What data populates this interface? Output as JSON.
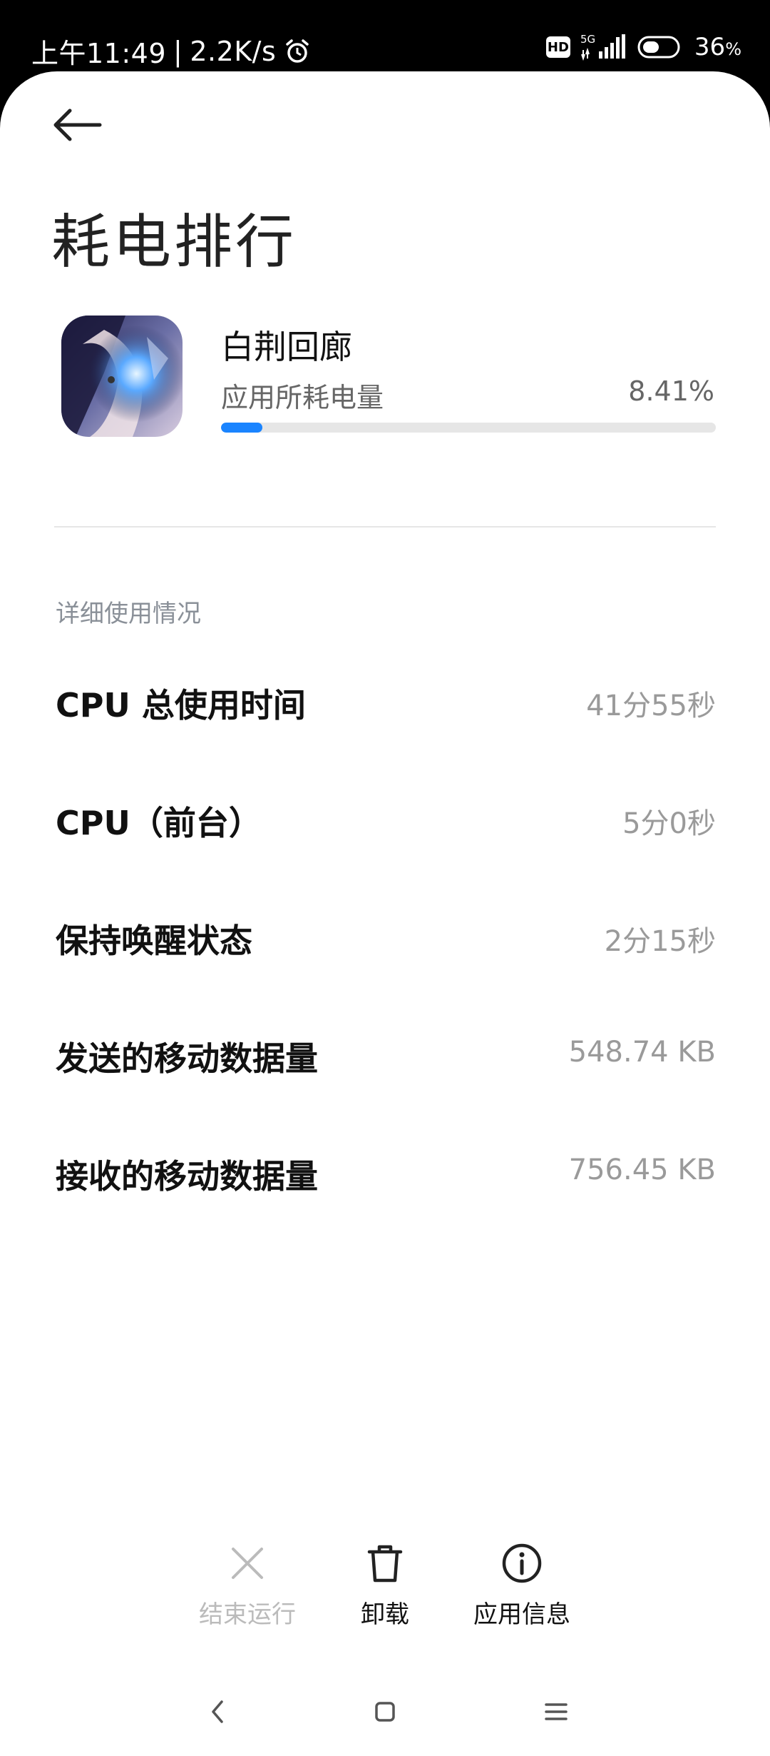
{
  "status_bar": {
    "time": "上午11:49",
    "net_speed": "2.2K/s",
    "hd": "HD",
    "network": "5G",
    "battery": "36",
    "battery_unit": "%",
    "icons": [
      "alarm-icon",
      "hd-icon",
      "signal-icon",
      "battery-icon"
    ]
  },
  "header": {
    "title": "耗电排行"
  },
  "app": {
    "name": "白荆回廊",
    "usage_label": "应用所耗电量",
    "usage_percent": "8.41%",
    "usage_fraction": 0.0841,
    "accent_color": "#1a84ff"
  },
  "details": {
    "section_title": "详细使用情况",
    "rows": [
      {
        "label": "CPU 总使用时间",
        "value": "41分55秒"
      },
      {
        "label": "CPU（前台）",
        "value": "5分0秒"
      },
      {
        "label": "保持唤醒状态",
        "value": "2分15秒"
      },
      {
        "label": "发送的移动数据量",
        "value": "548.74 KB"
      },
      {
        "label": "接收的移动数据量",
        "value": "756.45 KB"
      }
    ]
  },
  "actions": [
    {
      "label": "结束运行",
      "icon": "close-icon",
      "enabled": false
    },
    {
      "label": "卸载",
      "icon": "trash-icon",
      "enabled": true
    },
    {
      "label": "应用信息",
      "icon": "info-icon",
      "enabled": true
    }
  ],
  "nav_bar": {
    "icons": [
      "back-nav-icon",
      "home-nav-icon",
      "menu-nav-icon"
    ]
  }
}
